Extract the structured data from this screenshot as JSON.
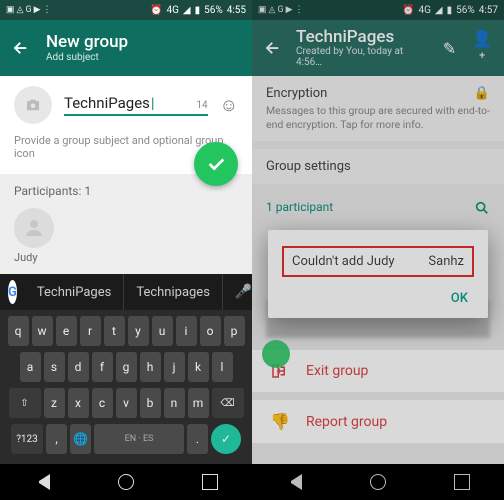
{
  "left": {
    "status": {
      "battery": "56%",
      "time": "4:55",
      "net": "4G"
    },
    "header": {
      "title": "New group",
      "subtitle": "Add subject"
    },
    "subject": {
      "value": "TechniPages",
      "remaining": "14"
    },
    "hint": "Provide a group subject and optional group icon",
    "participants_label": "Participants: 1",
    "participant_name": "Judy",
    "suggestions": [
      "TechniPages",
      "Technipages"
    ],
    "keyboard": {
      "row1": [
        "q",
        "w",
        "e",
        "r",
        "t",
        "y",
        "u",
        "i",
        "o",
        "p"
      ],
      "row2": [
        "a",
        "s",
        "d",
        "f",
        "g",
        "h",
        "j",
        "k",
        "l"
      ],
      "row3_shift": "⇧",
      "row3": [
        "z",
        "x",
        "c",
        "v",
        "b",
        "n",
        "m"
      ],
      "row3_del": "⌫",
      "row4": {
        "nums": "?123",
        "comma": ",",
        "globe": "🌐",
        "space": "EN · ES",
        "period": ".",
        "enter": "✓"
      }
    }
  },
  "right": {
    "status": {
      "battery": "56%",
      "time": "4:57",
      "net": "4G"
    },
    "header": {
      "title": "TechniPages",
      "subtitle": "Created by You, today at 4:56…"
    },
    "encryption": {
      "title": "Encryption",
      "text": "Messages to this group are secured with end-to-end encryption. Tap for more info."
    },
    "group_settings": "Group settings",
    "participants_head": "1 participant",
    "dialog": {
      "part1": "Couldn't add Judy",
      "part2": "Sanhz",
      "ok": "OK"
    },
    "exit": "Exit group",
    "report": "Report group"
  }
}
